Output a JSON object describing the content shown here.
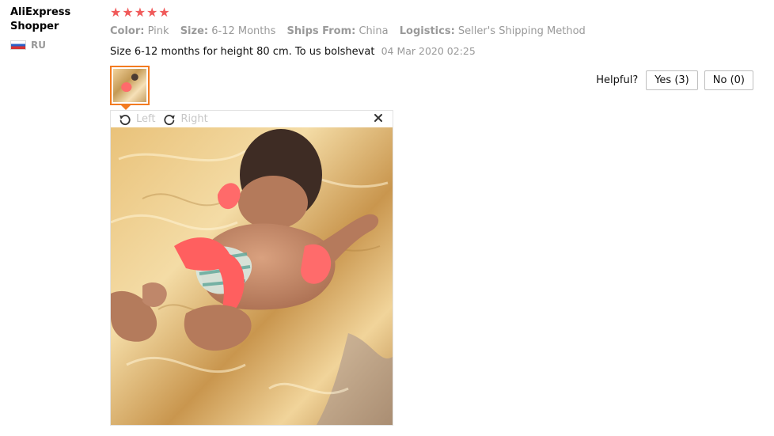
{
  "user": {
    "name": "AliExpress Shopper",
    "country": "RU",
    "flag_icon": "russia-flag-icon"
  },
  "review": {
    "rating": 5,
    "stars": [
      "★",
      "★",
      "★",
      "★",
      "★"
    ],
    "attributes": [
      {
        "key": "Color:",
        "value": "Pink"
      },
      {
        "key": "Size:",
        "value": "6-12 Months"
      },
      {
        "key": "Ships From:",
        "value": "China"
      },
      {
        "key": "Logistics:",
        "value": "Seller's Shipping Method"
      }
    ],
    "text": "Size 6-12 months for height 80 cm. To us bolshevat",
    "date": "04 Mar 2020 02:25"
  },
  "viewer": {
    "rotate_left_label": "Left",
    "rotate_right_label": "Right",
    "rotate_left_icon": "rotate-left-icon",
    "rotate_right_icon": "rotate-right-icon",
    "close_icon": "close-icon"
  },
  "helpful": {
    "label": "Helpful?",
    "yes_label": "Yes (3)",
    "no_label": "No (0)"
  },
  "colors": {
    "star": "#f05a5a",
    "thumb_border": "#f37b20",
    "muted_text": "#999999"
  }
}
